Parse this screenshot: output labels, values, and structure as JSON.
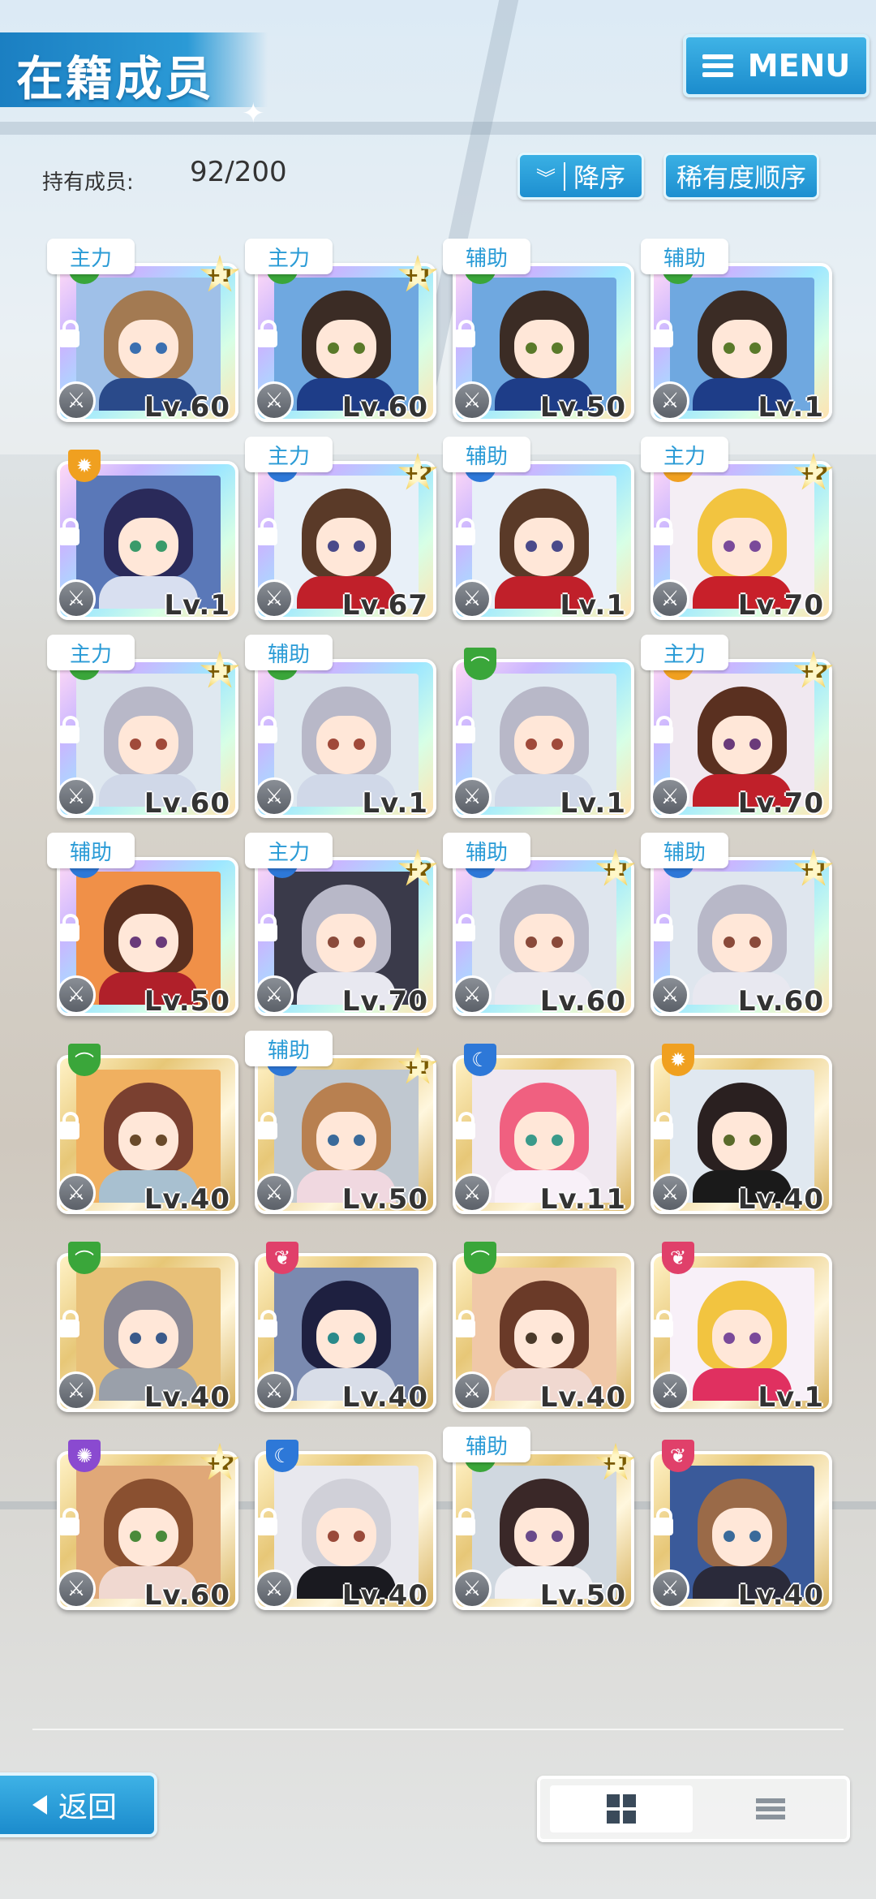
{
  "header": {
    "title": "在籍成员",
    "menu_label": "MENU"
  },
  "stats": {
    "count_label": "持有成员:",
    "count_value": "92/200"
  },
  "sort": {
    "order_label": "降序",
    "rarity_label": "稀有度顺序"
  },
  "footer": {
    "back_label": "返回"
  },
  "cards": [
    {
      "role": "主力",
      "plus": "+1",
      "level": "Lv.60",
      "frame": "rainbow",
      "badge": "green",
      "hair": "#a37a52",
      "eyes": "#3a6fb0",
      "outfit": "#2a4a8a",
      "bg": "#9fc0e8"
    },
    {
      "role": "主力",
      "plus": "+1",
      "level": "Lv.60",
      "frame": "rainbow",
      "badge": "green",
      "hair": "#3b2c25",
      "eyes": "#5a7a2a",
      "outfit": "#1e3d88",
      "bg": "#6fa8e0"
    },
    {
      "role": "辅助",
      "plus": "",
      "level": "Lv.50",
      "frame": "rainbow",
      "badge": "green",
      "hair": "#3b2c25",
      "eyes": "#5a7a2a",
      "outfit": "#1e3d88",
      "bg": "#6fa8e0"
    },
    {
      "role": "辅助",
      "plus": "",
      "level": "Lv.1",
      "frame": "rainbow",
      "badge": "green",
      "hair": "#3b2c25",
      "eyes": "#5a7a2a",
      "outfit": "#1e3d88",
      "bg": "#6fa8e0"
    },
    {
      "role": "",
      "plus": "",
      "level": "Lv.1",
      "frame": "rainbow",
      "badge": "orange",
      "hair": "#2a2a5a",
      "eyes": "#3a9a6a",
      "outfit": "#d8dff0",
      "bg": "#5a78b8"
    },
    {
      "role": "主力",
      "plus": "+2",
      "level": "Lv.67",
      "frame": "rainbow",
      "badge": "blue",
      "hair": "#5a3a28",
      "eyes": "#4a4a8a",
      "outfit": "#c0202a",
      "bg": "#e8f0f8"
    },
    {
      "role": "辅助",
      "plus": "",
      "level": "Lv.1",
      "frame": "rainbow",
      "badge": "blue",
      "hair": "#5a3a28",
      "eyes": "#4a4a8a",
      "outfit": "#c0202a",
      "bg": "#e8f0f8"
    },
    {
      "role": "主力",
      "plus": "+2",
      "level": "Lv.70",
      "frame": "rainbow",
      "badge": "orange",
      "hair": "#f2c440",
      "eyes": "#7a4a9a",
      "outfit": "#c8202a",
      "bg": "#f4eef4"
    },
    {
      "role": "主力",
      "plus": "+1",
      "level": "Lv.60",
      "frame": "rainbow",
      "badge": "green",
      "hair": "#b8b8c8",
      "eyes": "#a04a3a",
      "outfit": "#d0d8e8",
      "bg": "#dfe8f0"
    },
    {
      "role": "辅助",
      "plus": "",
      "level": "Lv.1",
      "frame": "rainbow",
      "badge": "green",
      "hair": "#b8b8c8",
      "eyes": "#a04a3a",
      "outfit": "#d0d8e8",
      "bg": "#dfe8f0"
    },
    {
      "role": "",
      "plus": "",
      "level": "Lv.1",
      "frame": "rainbow",
      "badge": "green",
      "hair": "#b8b8c8",
      "eyes": "#a04a3a",
      "outfit": "#d0d8e8",
      "bg": "#dfe8f0"
    },
    {
      "role": "主力",
      "plus": "+2",
      "level": "Lv.70",
      "frame": "rainbow",
      "badge": "orange",
      "hair": "#5a3020",
      "eyes": "#6a3a7a",
      "outfit": "#c0202a",
      "bg": "#f0e8f0"
    },
    {
      "role": "辅助",
      "plus": "",
      "level": "Lv.50",
      "frame": "rainbow",
      "badge": "blue",
      "hair": "#5a3020",
      "eyes": "#6a3a7a",
      "outfit": "#b0202a",
      "bg": "#f09048"
    },
    {
      "role": "主力",
      "plus": "+2",
      "level": "Lv.70",
      "frame": "rainbow",
      "badge": "blue",
      "hair": "#b8b8c8",
      "eyes": "#8a4a3a",
      "outfit": "#e8e8f0",
      "bg": "#3a3a4a"
    },
    {
      "role": "辅助",
      "plus": "+1",
      "level": "Lv.60",
      "frame": "rainbow",
      "badge": "blue",
      "hair": "#b8b8c8",
      "eyes": "#8a4a3a",
      "outfit": "#e8e8f0",
      "bg": "#dfe6ee"
    },
    {
      "role": "辅助",
      "plus": "+1",
      "level": "Lv.60",
      "frame": "rainbow",
      "badge": "blue",
      "hair": "#b8b8c8",
      "eyes": "#8a4a3a",
      "outfit": "#e8e8f0",
      "bg": "#dfe6ee"
    },
    {
      "role": "",
      "plus": "",
      "level": "Lv.40",
      "frame": "gold",
      "badge": "green",
      "hair": "#7a4030",
      "eyes": "#6a4a2a",
      "outfit": "#a8c0d0",
      "bg": "#f0b060"
    },
    {
      "role": "辅助",
      "plus": "+1",
      "level": "Lv.50",
      "frame": "gold",
      "badge": "blue",
      "hair": "#b88050",
      "eyes": "#3a6a9a",
      "outfit": "#f0d8e0",
      "bg": "#c0c8d0"
    },
    {
      "role": "",
      "plus": "",
      "level": "Lv.11",
      "frame": "gold",
      "badge": "blue",
      "hair": "#f06080",
      "eyes": "#3a9a8a",
      "outfit": "#f8f0f8",
      "bg": "#f0e8f0"
    },
    {
      "role": "",
      "plus": "",
      "level": "Lv.40",
      "frame": "gold",
      "badge": "orange",
      "hair": "#2a2020",
      "eyes": "#5a6a2a",
      "outfit": "#1a1a1a",
      "bg": "#e0e8f0"
    },
    {
      "role": "",
      "plus": "",
      "level": "Lv.40",
      "frame": "gold",
      "badge": "green",
      "hair": "#8a8894",
      "eyes": "#3a5a8a",
      "outfit": "#9aa0aa",
      "bg": "#e8c078"
    },
    {
      "role": "",
      "plus": "",
      "level": "Lv.40",
      "frame": "gold",
      "badge": "pink",
      "hair": "#1e2040",
      "eyes": "#2a8a8a",
      "outfit": "#d8dde8",
      "bg": "#7a8ab0"
    },
    {
      "role": "",
      "plus": "",
      "level": "Lv.40",
      "frame": "gold",
      "badge": "green",
      "hair": "#6a3a28",
      "eyes": "#4a3a2a",
      "outfit": "#f0d8d0",
      "bg": "#f0c8a8"
    },
    {
      "role": "",
      "plus": "",
      "level": "Lv.1",
      "frame": "gold",
      "badge": "pink",
      "hair": "#f2c440",
      "eyes": "#7a4a9a",
      "outfit": "#e03060",
      "bg": "#f8f0f8"
    },
    {
      "role": "",
      "plus": "+2",
      "level": "Lv.60",
      "frame": "gold",
      "badge": "purple",
      "hair": "#8a5030",
      "eyes": "#4a8a3a",
      "outfit": "#f0d8d0",
      "bg": "#e0a878"
    },
    {
      "role": "",
      "plus": "",
      "level": "Lv.40",
      "frame": "gold",
      "badge": "blue",
      "hair": "#d0d0d8",
      "eyes": "#9a4a3a",
      "outfit": "#1a1a20",
      "bg": "#e8e8ee"
    },
    {
      "role": "辅助",
      "plus": "+1",
      "level": "Lv.50",
      "frame": "gold",
      "badge": "green",
      "hair": "#3a2828",
      "eyes": "#6a4a8a",
      "outfit": "#f0f0f4",
      "bg": "#d0d8e0"
    },
    {
      "role": "",
      "plus": "",
      "level": "Lv.40",
      "frame": "gold",
      "badge": "pink",
      "hair": "#9a6a48",
      "eyes": "#3a6a9a",
      "outfit": "#2a2a3a",
      "bg": "#3a5a9a"
    }
  ]
}
